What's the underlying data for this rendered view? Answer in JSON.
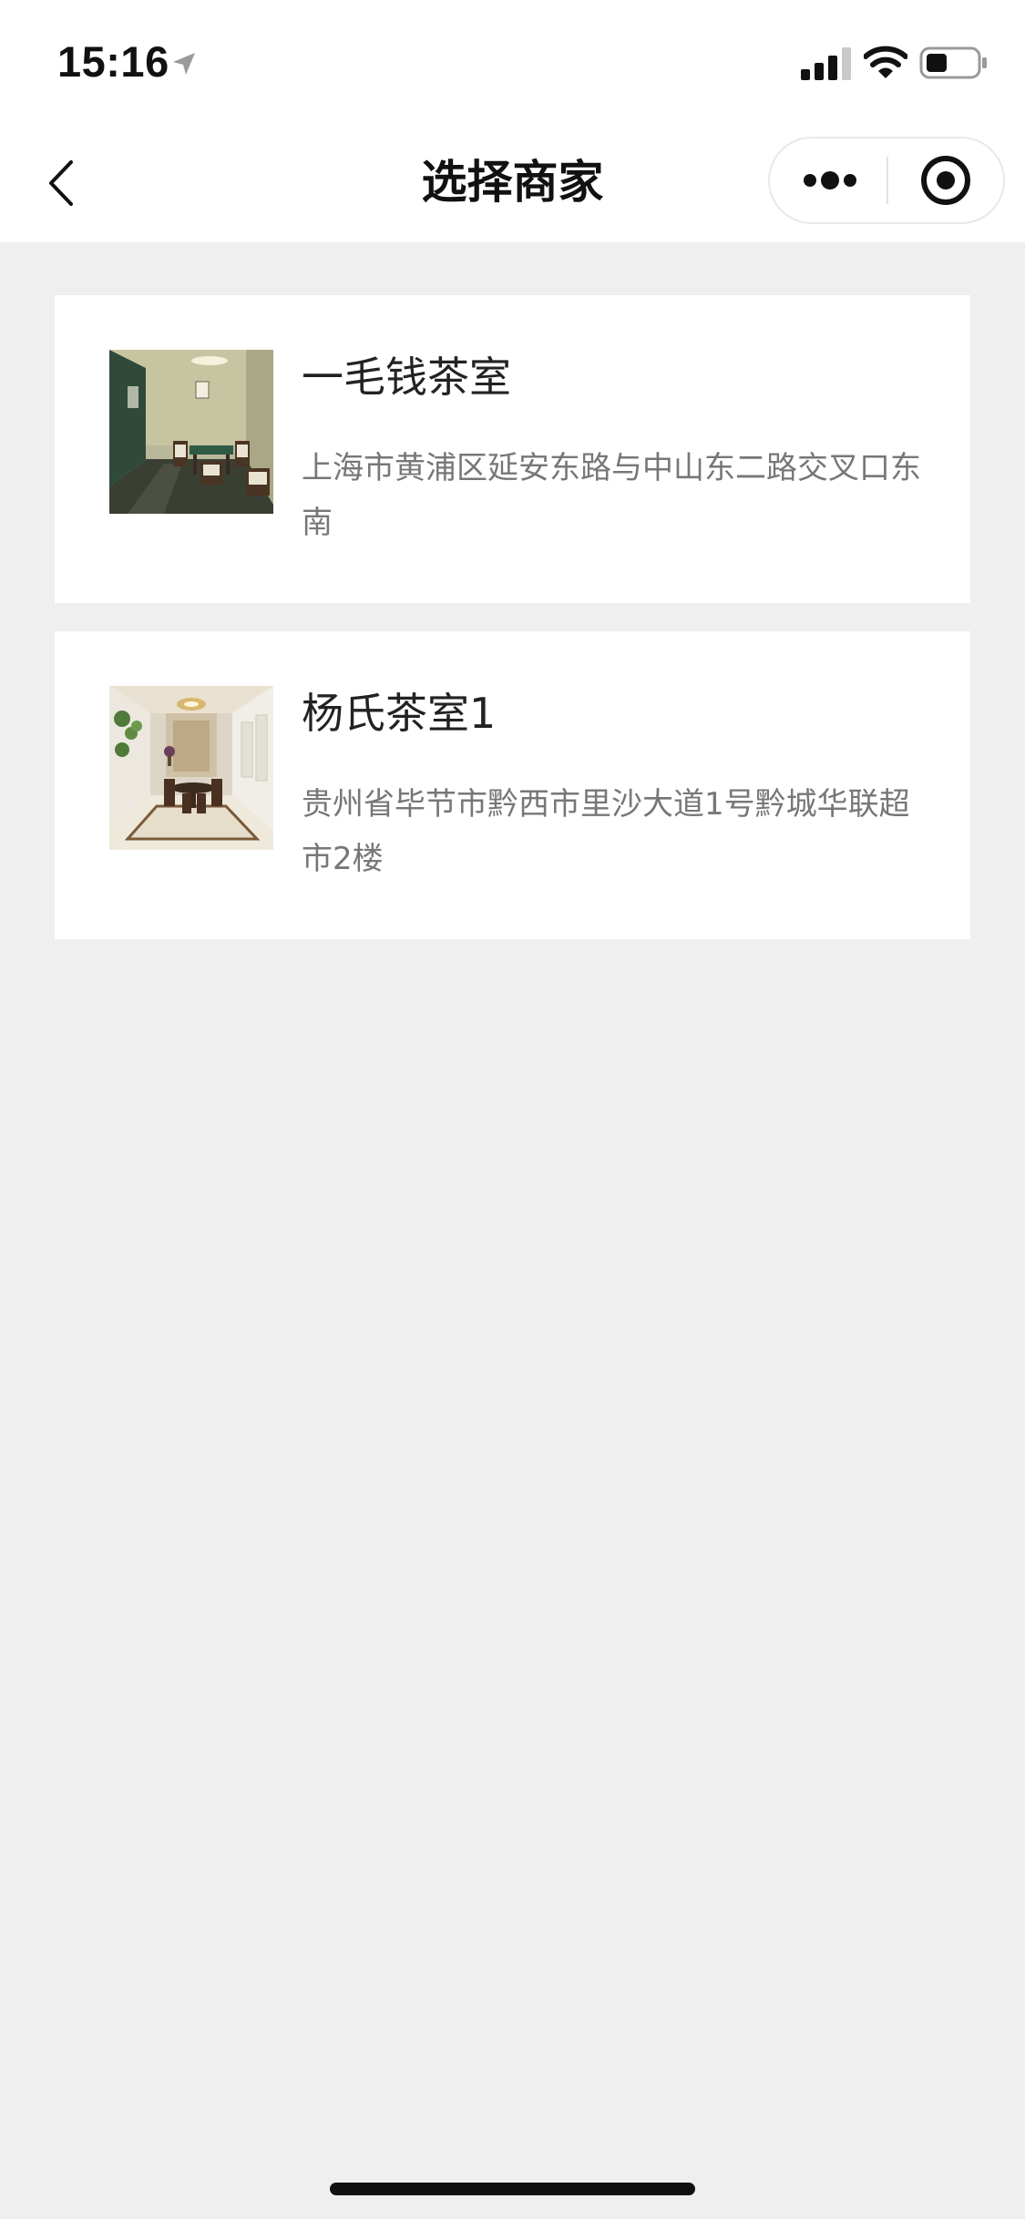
{
  "status_bar": {
    "time": "15:16",
    "icons": [
      "location-arrow-icon",
      "cellular-signal-icon",
      "wifi-icon",
      "battery-icon"
    ]
  },
  "nav": {
    "title": "选择商家",
    "icons": [
      "back-chevron-icon",
      "more-dots-icon",
      "close-target-icon"
    ]
  },
  "merchants": [
    {
      "name": "一毛钱茶室",
      "address": "上海市黄浦区延安东路与中山东二路交叉口东南",
      "thumbnail": "tea-room-interior-photo"
    },
    {
      "name": "杨氏茶室1",
      "address": "贵州省毕节市黔西市里沙大道1号黔城华联超市2楼",
      "thumbnail": "dining-room-interior-photo"
    }
  ],
  "colors": {
    "background": "#efefef",
    "card": "#ffffff",
    "title_text": "#111111",
    "name_text": "#222222",
    "address_text": "#777777"
  }
}
